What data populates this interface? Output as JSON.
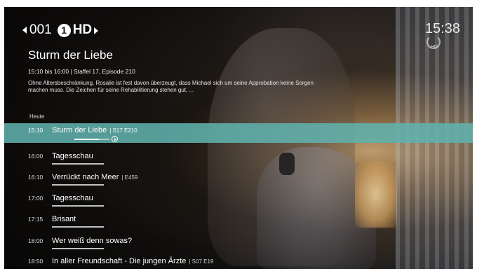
{
  "channel": {
    "number": "001",
    "logo_mark": "1",
    "logo_text": "HD"
  },
  "clock": "15:38",
  "hd_indicator": "HD",
  "program": {
    "title": "Sturm der Liebe",
    "meta": "15:10 bis 16:00  |  Staffel 17, Episode 210",
    "description": "Ohne Altersbeschränkung. Rosalie ist fest davon überzeugt, dass Michael sich um seine Approbation keine Sorgen machen muss. Die Zeichen für seine Rehabilitierung stehen gut, ..."
  },
  "day_label": "Heute",
  "schedule": [
    {
      "time": "15:10",
      "title": "Sturm der Liebe",
      "episode": "| S17 E210",
      "selected": true,
      "progress": 0.7
    },
    {
      "time": "16:00",
      "title": "Tagesschau",
      "episode": ""
    },
    {
      "time": "16:10",
      "title": "Verrückt nach Meer",
      "episode": "| E459"
    },
    {
      "time": "17:00",
      "title": "Tagesschau",
      "episode": ""
    },
    {
      "time": "17:15",
      "title": "Brisant",
      "episode": ""
    },
    {
      "time": "18:00",
      "title": "Wer weiß denn sowas?",
      "episode": ""
    },
    {
      "time": "18:50",
      "title": "In aller Freundschaft - Die jungen Ärzte",
      "episode": "| S07 E19"
    }
  ],
  "colors": {
    "accent": "#60b0ac"
  }
}
